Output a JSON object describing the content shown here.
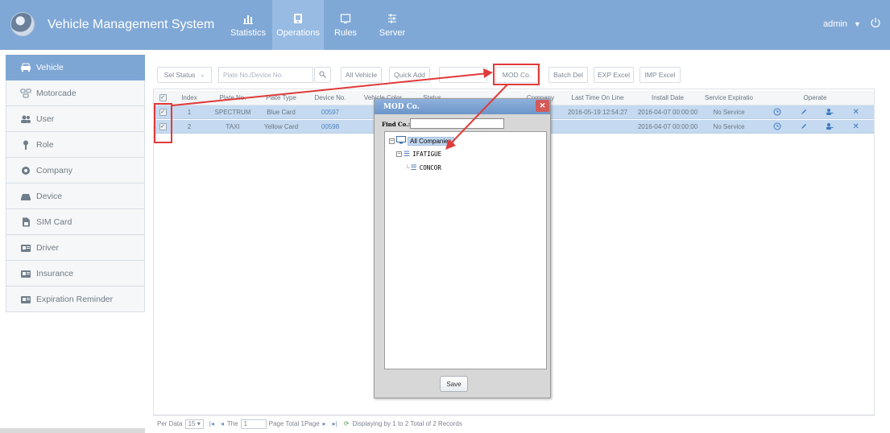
{
  "header": {
    "title": "Vehicle Management System",
    "nav": [
      {
        "label": "Statistics",
        "icon": "bar-chart-icon",
        "active": false
      },
      {
        "label": "Operations",
        "icon": "tablet-icon",
        "active": true
      },
      {
        "label": "Rules",
        "icon": "monitor-icon",
        "active": false
      },
      {
        "label": "Server",
        "icon": "sliders-icon",
        "active": false
      }
    ],
    "user": "admin",
    "user_icon": "caret-down-icon",
    "power_icon": "power-icon"
  },
  "sidebar": {
    "items": [
      {
        "label": "Vehicle",
        "icon": "car-icon",
        "active": true
      },
      {
        "label": "Motorcade",
        "icon": "convoy-icon",
        "active": false
      },
      {
        "label": "User",
        "icon": "users-icon",
        "active": false
      },
      {
        "label": "Role",
        "icon": "role-icon",
        "active": false
      },
      {
        "label": "Company",
        "icon": "company-icon",
        "active": false
      },
      {
        "label": "Device",
        "icon": "device-icon",
        "active": false
      },
      {
        "label": "SIM Card",
        "icon": "sim-card-icon",
        "active": false
      },
      {
        "label": "Driver",
        "icon": "driver-card-icon",
        "active": false
      },
      {
        "label": "Insurance",
        "icon": "insurance-icon",
        "active": false
      },
      {
        "label": "Expiration Reminder",
        "icon": "reminder-icon",
        "active": false
      }
    ]
  },
  "toolbar": {
    "sel_status": "Sel Status",
    "search_placeholder": "Plate No./Device No.",
    "all_vehicle": "All Vehicle",
    "quick_add": "Quick Add",
    "mod_co": "MOD Co.",
    "batch_del": "Batch Del",
    "exp_excel": "EXP Excel",
    "imp_excel": "IMP Excel"
  },
  "grid": {
    "headers": {
      "index": "Index",
      "plate_no": "Plate No.",
      "plate_type": "Plate Type",
      "device_no": "Device No.",
      "vehicle_color": "Vehicle Color",
      "status": "Status",
      "company": "Company",
      "last_online": "Last Time On Line",
      "install_date": "Install Date",
      "service_expiration": "Service Expiratio",
      "operate": "Operate"
    },
    "rows": [
      {
        "checked": true,
        "index": "1",
        "plate_no": "SPECTRUM",
        "plate_type": "Blue Card",
        "device_no": "00597",
        "last_online": "2016-05-19 12:54:27",
        "install_date": "2016-04-07 00:00:00",
        "service_expiration": "No Service"
      },
      {
        "checked": true,
        "index": "2",
        "plate_no": "TAXI",
        "plate_type": "Yellow Card",
        "device_no": "00598",
        "last_online": "",
        "install_date": "2016-04-07 00:00:00",
        "service_expiration": "No Service"
      }
    ],
    "operate_icons": [
      "detail-icon",
      "edit-icon",
      "assign-user-icon",
      "delete-icon"
    ]
  },
  "pager": {
    "per_data_label": "Per Data",
    "per_data_value": "15",
    "the_label": "The",
    "page_value": "1",
    "page_total": "Page  Total 1Page",
    "display_text": "Displaying by 1 to 2 Total of 2 Records"
  },
  "modal": {
    "title": "MOD Co.",
    "find_label": "Find Co.:",
    "tree": {
      "root": "All Companies",
      "child": "IFATIGUE",
      "grandchild": "CONCOR"
    },
    "save": "Save"
  },
  "colors": {
    "header_bg": "#80a8d6",
    "active_nav": "#97bbe3",
    "row_selected": "#c5daf0",
    "annotation_red": "#e03a3a"
  }
}
